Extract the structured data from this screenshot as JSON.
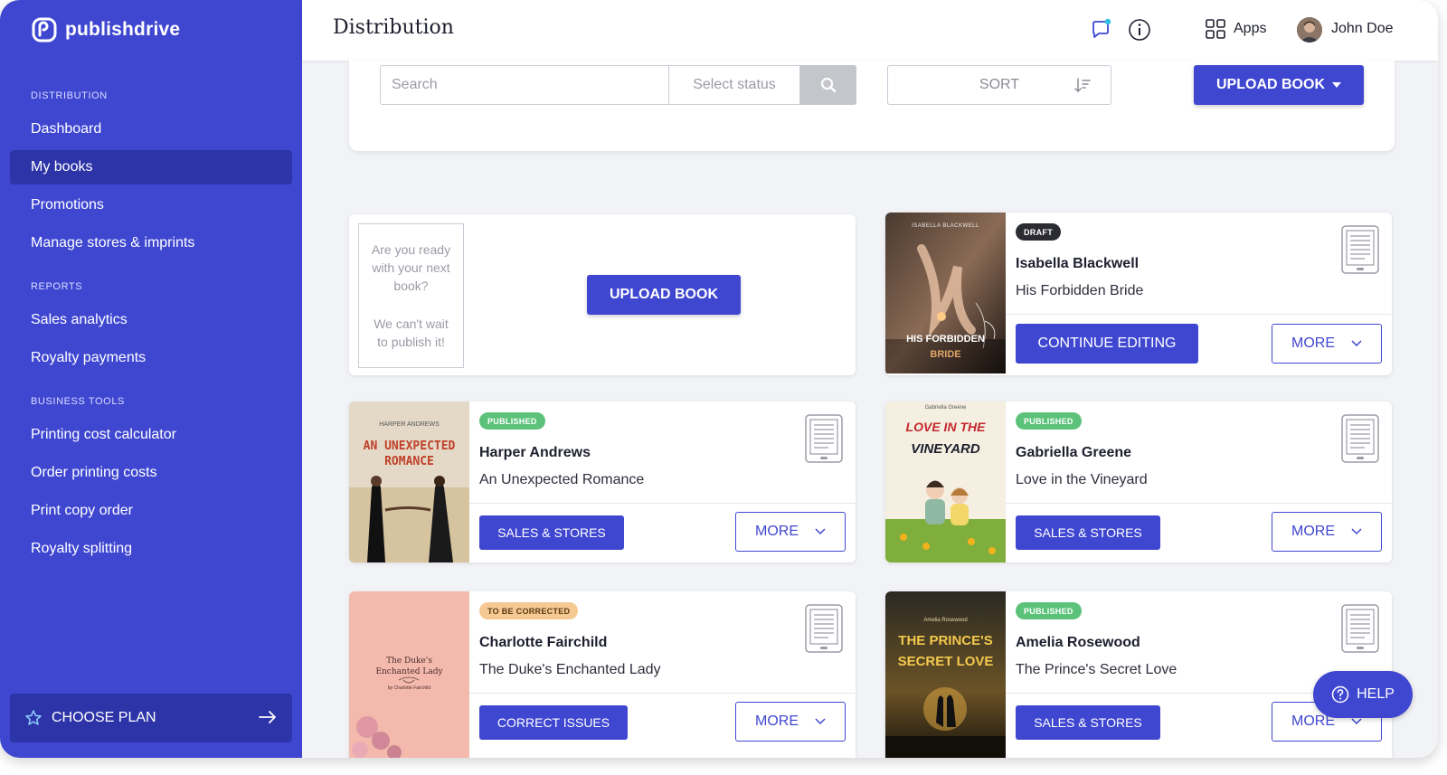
{
  "brand": {
    "name": "publishdrive"
  },
  "sidebar": {
    "sections": [
      {
        "label": "DISTRIBUTION",
        "items": [
          {
            "label": "Dashboard"
          },
          {
            "label": "My books",
            "active": true
          },
          {
            "label": "Promotions"
          },
          {
            "label": "Manage stores & imprints"
          }
        ]
      },
      {
        "label": "REPORTS",
        "items": [
          {
            "label": "Sales analytics"
          },
          {
            "label": "Royalty payments"
          }
        ]
      },
      {
        "label": "BUSINESS TOOLS",
        "items": [
          {
            "label": "Printing cost calculator"
          },
          {
            "label": "Order printing costs"
          },
          {
            "label": "Print copy order"
          },
          {
            "label": "Royalty splitting"
          }
        ]
      }
    ],
    "choose_plan": "CHOOSE PLAN"
  },
  "header": {
    "title": "Distribution",
    "apps": "Apps",
    "user": "John Doe"
  },
  "filters": {
    "search_placeholder": "Search",
    "status_placeholder": "Select status",
    "sort": "SORT",
    "upload": "UPLOAD BOOK"
  },
  "promo": {
    "note_line1": "Are you ready with your next book?",
    "note_line2": "We can't wait to publish it!",
    "upload": "UPLOAD BOOK"
  },
  "books": [
    {
      "status": "DRAFT",
      "author": "Isabella Blackwell",
      "title": "His Forbidden Bride",
      "action": "CONTINUE EDITING",
      "more": "MORE",
      "cover": {
        "author": "ISABELLA BLACKWELL",
        "title1": "HIS FORBIDDEN",
        "title2": "BRIDE"
      }
    },
    {
      "status": "PUBLISHED",
      "author": "Harper Andrews",
      "title": "An Unexpected Romance",
      "action": "SALES & STORES",
      "more": "MORE",
      "cover": {
        "author": "HARPER ANDREWS",
        "title1": "AN UNEXPECTED",
        "title2": "ROMANCE"
      }
    },
    {
      "status": "PUBLISHED",
      "author": "Gabriella Greene",
      "title": "Love in the Vineyard",
      "action": "SALES & STORES",
      "more": "MORE",
      "cover": {
        "author": "Gabriella Greene",
        "title1": "LOVE IN THE",
        "title2": "VINEYARD"
      }
    },
    {
      "status": "TO BE CORRECTED",
      "author": "Charlotte Fairchild",
      "title": "The Duke's Enchanted Lady",
      "action": "CORRECT ISSUES",
      "more": "MORE",
      "cover": {
        "author": "by Charlotte Fairchild",
        "title1": "The Duke's",
        "title2": "Enchanted Lady"
      }
    },
    {
      "status": "PUBLISHED",
      "author": "Amelia Rosewood",
      "title": "The Prince's Secret Love",
      "action": "SALES & STORES",
      "more": "MORE",
      "cover": {
        "author": "Amelia Rosewood",
        "title1": "THE PRINCE'S",
        "title2": "SECRET LOVE"
      }
    }
  ],
  "help": "HELP",
  "colors": {
    "brand": "#3f47d1",
    "brand_dark": "#2d34a8",
    "published": "#5cc27a",
    "draft": "#2b2b33",
    "to_be_corrected": "#f6c892"
  }
}
